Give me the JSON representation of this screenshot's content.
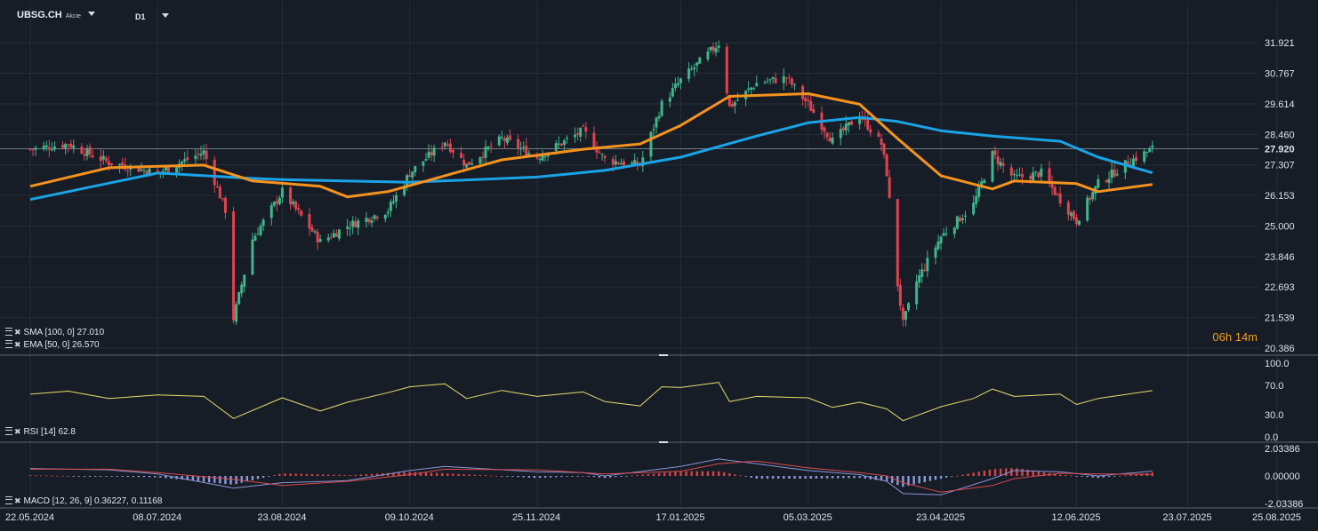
{
  "header": {
    "symbol": "UBSG.CH",
    "instrument_type": "Akcie",
    "timeframe": "D1"
  },
  "timer": "06h 14m",
  "colors": {
    "background": "#161d26",
    "grid": "#242e39",
    "up": "#3fb58a",
    "down": "#e0434f",
    "sma": "#1aa3e6",
    "ema": "#f5921d",
    "rsi": "#e7dd6e",
    "macd_line": "#8894d4",
    "signal_line": "#d9494f",
    "hist_pos": "#d8424a",
    "hist_neg": "#8e9ad8",
    "axis_text": "#dfe3e8",
    "current_price_line": "#6f7a86"
  },
  "indicators": {
    "sma_label": "SMA [100, 0]",
    "sma_value": "27.010",
    "ema_label": "EMA [50, 0]",
    "ema_value": "26.570",
    "rsi_label": "RSI [14]",
    "rsi_value": "62.8",
    "macd_label": "MACD [12, 26, 9]",
    "macd_values": "0.36227,  0.11168"
  },
  "chart_data": {
    "type": "candlestick",
    "x_labels": [
      "22.05.2024",
      "08.07.2024",
      "23.08.2024",
      "09.10.2024",
      "25.11.2024",
      "17.01.2025",
      "05.03.2025",
      "23.04.2025",
      "12.06.2025",
      "23.07.2025",
      "25.08.2025"
    ],
    "x_range": [
      "2024-05-22",
      "2025-08-25"
    ],
    "last_candle_date": "2025-07-10",
    "current_price": "27.920",
    "price_axis": {
      "ticks": [
        "31.921",
        "30.767",
        "29.614",
        "28.460",
        "27.307",
        "26.153",
        "25.000",
        "23.846",
        "22.693",
        "21.539",
        "20.386"
      ],
      "range": [
        20.386,
        32.6
      ]
    },
    "rsi_axis": {
      "ticks": [
        "100.0",
        "70.0",
        "30.0",
        "0.0"
      ],
      "range": [
        0,
        100
      ]
    },
    "macd_axis": {
      "ticks": [
        "2.03386",
        "0.00000",
        "-2.03386"
      ],
      "range": [
        -2.03386,
        2.03386
      ]
    },
    "price_series": [
      [
        "2024-05-22",
        27.9
      ],
      [
        "2024-06-05",
        28.1
      ],
      [
        "2024-06-20",
        27.4
      ],
      [
        "2024-07-08",
        27.0
      ],
      [
        "2024-07-25",
        27.8
      ],
      [
        "2024-08-02",
        25.6
      ],
      [
        "2024-08-05",
        21.5
      ],
      [
        "2024-08-12",
        24.5
      ],
      [
        "2024-08-23",
        26.3
      ],
      [
        "2024-09-06",
        24.4
      ],
      [
        "2024-09-16",
        25.0
      ],
      [
        "2024-10-01",
        25.6
      ],
      [
        "2024-10-09",
        27.0
      ],
      [
        "2024-10-22",
        28.2
      ],
      [
        "2024-10-30",
        27.3
      ],
      [
        "2024-11-12",
        28.3
      ],
      [
        "2024-11-25",
        27.6
      ],
      [
        "2024-12-12",
        28.6
      ],
      [
        "2024-12-20",
        27.5
      ],
      [
        "2025-01-02",
        27.3
      ],
      [
        "2025-01-10",
        29.6
      ],
      [
        "2025-01-17",
        30.5
      ],
      [
        "2025-01-31",
        31.9
      ],
      [
        "2025-02-04",
        29.5
      ],
      [
        "2025-02-14",
        30.4
      ],
      [
        "2025-02-25",
        30.6
      ],
      [
        "2025-03-05",
        29.6
      ],
      [
        "2025-03-14",
        28.2
      ],
      [
        "2025-03-24",
        29.2
      ],
      [
        "2025-04-01",
        28.1
      ],
      [
        "2025-04-03",
        27.0
      ],
      [
        "2025-04-07",
        22.8
      ],
      [
        "2025-04-09",
        21.3
      ],
      [
        "2025-04-14",
        22.9
      ],
      [
        "2025-04-23",
        24.6
      ],
      [
        "2025-05-05",
        25.8
      ],
      [
        "2025-05-12",
        27.7
      ],
      [
        "2025-05-20",
        26.8
      ],
      [
        "2025-05-30",
        27.0
      ],
      [
        "2025-06-06",
        26.0
      ],
      [
        "2025-06-12",
        25.2
      ],
      [
        "2025-06-20",
        26.6
      ],
      [
        "2025-07-01",
        27.4
      ],
      [
        "2025-07-10",
        27.92
      ]
    ],
    "sma_series": [
      [
        "2024-05-22",
        26.0
      ],
      [
        "2024-07-08",
        27.0
      ],
      [
        "2024-08-12",
        26.8
      ],
      [
        "2024-08-23",
        26.75
      ],
      [
        "2024-10-09",
        26.65
      ],
      [
        "2024-11-25",
        26.85
      ],
      [
        "2024-12-20",
        27.1
      ],
      [
        "2025-01-17",
        27.6
      ],
      [
        "2025-02-14",
        28.4
      ],
      [
        "2025-03-05",
        28.9
      ],
      [
        "2025-03-24",
        29.1
      ],
      [
        "2025-04-07",
        28.95
      ],
      [
        "2025-04-23",
        28.6
      ],
      [
        "2025-05-12",
        28.4
      ],
      [
        "2025-06-06",
        28.2
      ],
      [
        "2025-06-20",
        27.6
      ],
      [
        "2025-07-10",
        27.01
      ]
    ],
    "ema_series": [
      [
        "2024-05-22",
        26.5
      ],
      [
        "2024-06-20",
        27.2
      ],
      [
        "2024-07-25",
        27.3
      ],
      [
        "2024-08-12",
        26.7
      ],
      [
        "2024-09-06",
        26.5
      ],
      [
        "2024-09-16",
        26.1
      ],
      [
        "2024-10-01",
        26.3
      ],
      [
        "2024-10-22",
        26.9
      ],
      [
        "2024-11-12",
        27.5
      ],
      [
        "2024-12-12",
        27.9
      ],
      [
        "2025-01-02",
        28.1
      ],
      [
        "2025-01-17",
        28.8
      ],
      [
        "2025-02-04",
        29.9
      ],
      [
        "2025-03-05",
        30.0
      ],
      [
        "2025-03-24",
        29.6
      ],
      [
        "2025-04-07",
        28.3
      ],
      [
        "2025-04-23",
        26.9
      ],
      [
        "2025-05-12",
        26.4
      ],
      [
        "2025-05-20",
        26.7
      ],
      [
        "2025-06-12",
        26.6
      ],
      [
        "2025-06-20",
        26.3
      ],
      [
        "2025-07-10",
        26.57
      ]
    ],
    "rsi_series": [
      [
        "2024-05-22",
        58
      ],
      [
        "2024-06-05",
        62
      ],
      [
        "2024-06-20",
        52
      ],
      [
        "2024-07-08",
        57
      ],
      [
        "2024-07-25",
        55
      ],
      [
        "2024-08-05",
        25
      ],
      [
        "2024-08-23",
        53
      ],
      [
        "2024-09-06",
        35
      ],
      [
        "2024-09-16",
        47
      ],
      [
        "2024-10-01",
        60
      ],
      [
        "2024-10-09",
        68
      ],
      [
        "2024-10-22",
        72
      ],
      [
        "2024-10-30",
        52
      ],
      [
        "2024-11-12",
        63
      ],
      [
        "2024-11-25",
        55
      ],
      [
        "2024-12-12",
        61
      ],
      [
        "2024-12-20",
        48
      ],
      [
        "2025-01-02",
        42
      ],
      [
        "2025-01-10",
        68
      ],
      [
        "2025-01-17",
        67
      ],
      [
        "2025-01-31",
        74
      ],
      [
        "2025-02-04",
        48
      ],
      [
        "2025-02-14",
        55
      ],
      [
        "2025-03-05",
        53
      ],
      [
        "2025-03-14",
        40
      ],
      [
        "2025-03-24",
        47
      ],
      [
        "2025-04-03",
        38
      ],
      [
        "2025-04-09",
        22
      ],
      [
        "2025-04-23",
        41
      ],
      [
        "2025-05-05",
        52
      ],
      [
        "2025-05-12",
        65
      ],
      [
        "2025-05-20",
        55
      ],
      [
        "2025-06-06",
        58
      ],
      [
        "2025-06-12",
        44
      ],
      [
        "2025-06-20",
        52
      ],
      [
        "2025-07-10",
        62.8
      ]
    ],
    "macd_series": [
      [
        "2024-05-22",
        0.55,
        0.5
      ],
      [
        "2024-06-20",
        0.45,
        0.5
      ],
      [
        "2024-07-08",
        0.15,
        0.25
      ],
      [
        "2024-08-05",
        -0.9,
        -0.25
      ],
      [
        "2024-08-23",
        -0.5,
        -0.7
      ],
      [
        "2024-09-16",
        -0.35,
        -0.4
      ],
      [
        "2024-10-09",
        0.4,
        0.1
      ],
      [
        "2024-10-22",
        0.7,
        0.5
      ],
      [
        "2024-11-25",
        0.3,
        0.45
      ],
      [
        "2024-12-12",
        0.25,
        0.25
      ],
      [
        "2024-12-20",
        0.0,
        0.15
      ],
      [
        "2025-01-17",
        0.7,
        0.35
      ],
      [
        "2025-01-31",
        1.25,
        0.9
      ],
      [
        "2025-02-14",
        0.9,
        1.1
      ],
      [
        "2025-03-05",
        0.4,
        0.6
      ],
      [
        "2025-03-24",
        0.1,
        0.25
      ],
      [
        "2025-04-03",
        -0.4,
        0.0
      ],
      [
        "2025-04-09",
        -1.3,
        -0.5
      ],
      [
        "2025-04-23",
        -1.4,
        -1.2
      ],
      [
        "2025-05-12",
        -0.2,
        -0.7
      ],
      [
        "2025-05-20",
        0.4,
        -0.2
      ],
      [
        "2025-06-06",
        0.3,
        0.2
      ],
      [
        "2025-06-20",
        0.0,
        0.15
      ],
      [
        "2025-07-10",
        0.36227,
        0.11168
      ]
    ]
  }
}
